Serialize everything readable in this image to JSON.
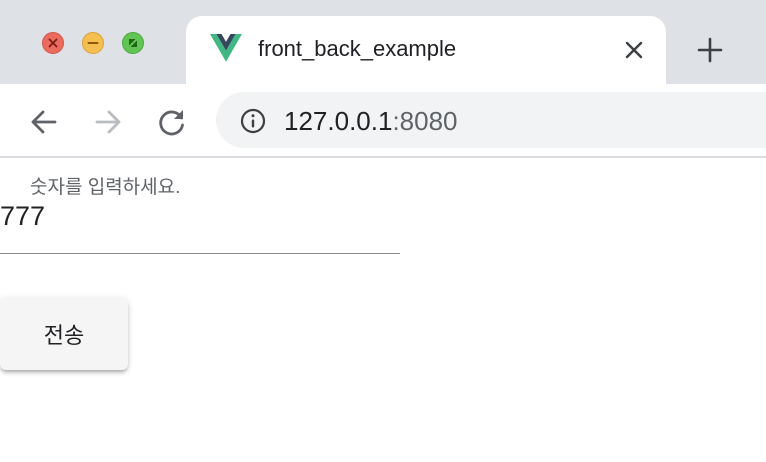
{
  "browser": {
    "tab": {
      "title": "front_back_example",
      "favicon": "vue-logo-icon"
    },
    "address_bar": {
      "host": "127.0.0.1",
      "port": ":8080"
    },
    "icons": {
      "close_window": "close-window-icon",
      "minimize_window": "minimize-window-icon",
      "maximize_window": "maximize-window-icon",
      "back": "arrow-left-icon",
      "forward": "arrow-right-icon",
      "reload": "reload-icon",
      "site_info": "info-icon",
      "tab_close": "close-icon",
      "new_tab": "plus-icon"
    },
    "colors": {
      "tab_strip": "#dee1e6",
      "omnibox": "#f1f3f4",
      "traffic_close": "#ec6a5e",
      "traffic_minimize": "#f4bf4f",
      "traffic_maximize": "#61c554",
      "vue_green": "#41b883",
      "vue_dark": "#35495e"
    }
  },
  "page": {
    "number_field": {
      "label": "숫자를 입력하세요.",
      "value": "777"
    },
    "submit_button": {
      "label": "전송"
    }
  }
}
